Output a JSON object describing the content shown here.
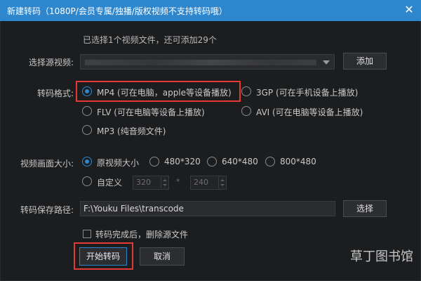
{
  "window": {
    "title": "新建转码（1080P/会员专属/独播/版权视频不支持转码哦）",
    "close_glyph": "✕"
  },
  "source": {
    "hint": "已选择1个视频文件，还可添加29个",
    "label": "选择源视频:",
    "add_button": "添加"
  },
  "format": {
    "label": "转码格式:",
    "options": [
      {
        "label": "MP4 (可在电脑，apple等设备播放)",
        "selected": true
      },
      {
        "label": "3GP (可在手机设备上播放)",
        "selected": false
      },
      {
        "label": "FLV (可在电脑等设备上播放)",
        "selected": false
      },
      {
        "label": "AVI (可在电脑等设备上播放)",
        "selected": false
      },
      {
        "label": "MP3 (纯音频文件)",
        "selected": false
      }
    ]
  },
  "size": {
    "label": "视频画面大小:",
    "options": [
      {
        "label": "原视频大小",
        "selected": true
      },
      {
        "label": "480*320",
        "selected": false
      },
      {
        "label": "640*480",
        "selected": false
      },
      {
        "label": "800*480",
        "selected": false
      },
      {
        "label": "自定义",
        "selected": false
      }
    ],
    "custom_width": "320",
    "custom_height": "240",
    "separator": "*"
  },
  "path": {
    "label": "转码保存路径:",
    "value": "F:\\Youku Files\\transcode",
    "browse_button": "选择"
  },
  "delete_after": {
    "label": "转码完成后，删除源文件",
    "checked": false
  },
  "actions": {
    "start_button": "开始转码",
    "cancel_button": "取消"
  },
  "watermark": {
    "text": "草丁图书馆"
  },
  "colors": {
    "title_bar": "#2e86cd",
    "background": "#1c1d1f",
    "highlight_box": "#e53935",
    "radio_selected": "#2e86cd"
  }
}
